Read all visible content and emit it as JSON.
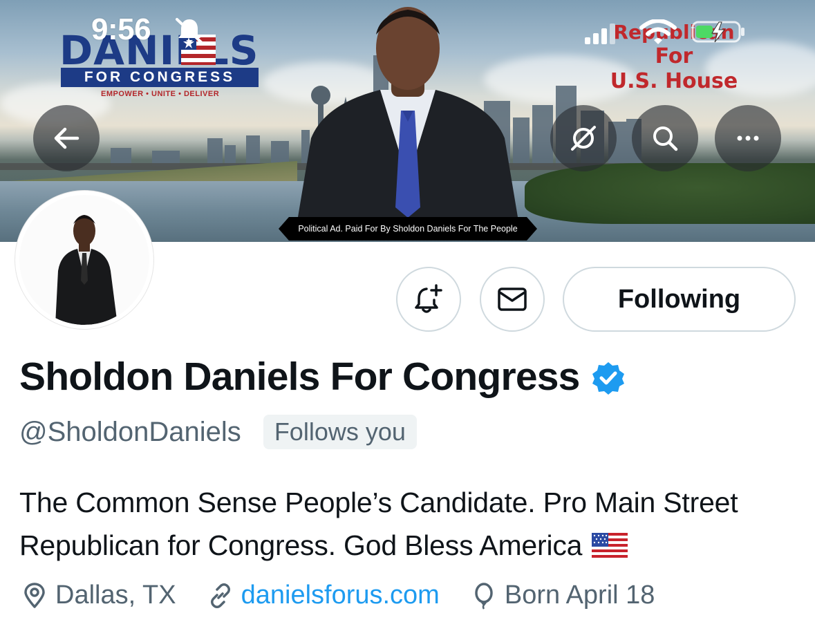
{
  "status_bar": {
    "time": "9:56"
  },
  "banner": {
    "logo_name": "DANIELS",
    "logo_bar": "FOR CONGRESS",
    "logo_tagline": "EMPOWER • UNITE • DELIVER",
    "republican_line1": "Republican",
    "republican_line2": "For",
    "republican_line3": "U.S. House",
    "disclaimer": "Political Ad. Paid For By Sholdon Daniels For The People"
  },
  "actions": {
    "following_label": "Following"
  },
  "profile": {
    "display_name": "Sholdon Daniels For Congress",
    "handle": "@SholdonDaniels",
    "follows_you": "Follows you",
    "bio": "The Common Sense People’s Candidate. Pro Main Street Republican for Congress. God Bless America",
    "location": "Dallas, TX",
    "website": "danielsforus.com",
    "birthday": "Born April 18"
  },
  "colors": {
    "verified_badge": "#1d9bf0",
    "link": "#1d9bf0",
    "secondary_text": "#536471",
    "primary_text": "#0f1419",
    "button_border": "#cfd9de"
  },
  "icons": {
    "back": "arrow-left-icon",
    "grok": "grok-icon",
    "search": "search-icon",
    "more": "more-horizontal-icon",
    "notify": "bell-plus-icon",
    "message": "envelope-icon",
    "verified": "verified-badge-icon",
    "location": "location-pin-icon",
    "link": "link-icon",
    "birthday": "balloon-icon"
  }
}
